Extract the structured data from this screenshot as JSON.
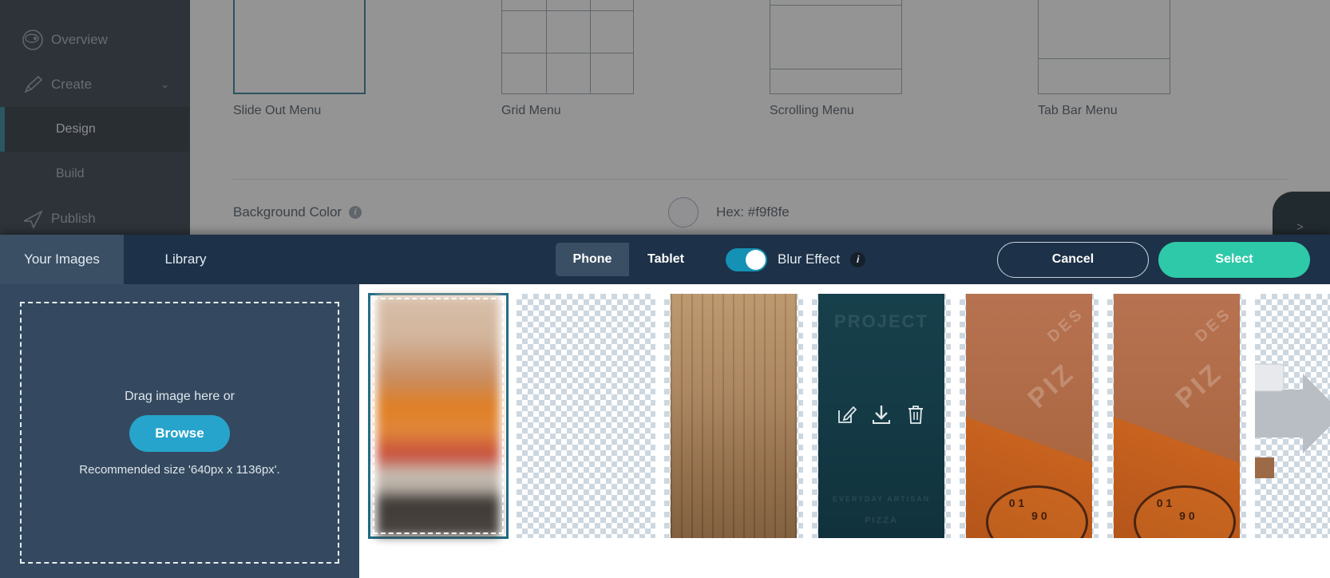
{
  "app": {
    "sidebar": {
      "items": [
        {
          "label": "Overview",
          "icon": "gauge-icon",
          "type": "top"
        },
        {
          "label": "Create",
          "icon": "pencil-icon",
          "type": "group",
          "chevron": "⌄"
        },
        {
          "label": "Design",
          "icon": "",
          "type": "sub",
          "active": true
        },
        {
          "label": "Build",
          "icon": "",
          "type": "sub",
          "active": false
        },
        {
          "label": "Publish",
          "icon": "send-icon",
          "type": "top"
        }
      ]
    },
    "templates": [
      {
        "caption": "Slide Out Menu",
        "kind": "slideout",
        "selected": true
      },
      {
        "caption": "Grid Menu",
        "kind": "grid",
        "selected": false
      },
      {
        "caption": "Scrolling Menu",
        "kind": "scrolling",
        "selected": false
      },
      {
        "caption": "Tab Bar Menu",
        "kind": "tabbar",
        "selected": false
      }
    ],
    "background_color": {
      "label": "Background Color",
      "info_icon": "info-icon",
      "hex_text": "Hex: #f9f8fe",
      "swatch_hex": "#f9f8fe"
    },
    "right_drawer_handle": ">"
  },
  "modal": {
    "tabs": [
      {
        "label": "Your Images",
        "active": true
      },
      {
        "label": "Library",
        "active": false
      }
    ],
    "device_segmented": [
      {
        "label": "Phone",
        "active": true
      },
      {
        "label": "Tablet",
        "active": false
      }
    ],
    "blur_effect": {
      "label": "Blur Effect",
      "enabled": true,
      "info_icon": "info-icon",
      "info_glyph": "i"
    },
    "buttons": {
      "cancel": "Cancel",
      "select": "Select"
    },
    "dropzone": {
      "drag_text": "Drag image here or",
      "browse_label": "Browse",
      "recommended": "Recommended size '640px x 1136px'."
    },
    "gallery": {
      "thumbnails": [
        {
          "id": 1,
          "kind": "blur-orange",
          "selected": true,
          "hover": false,
          "checker": false
        },
        {
          "id": 2,
          "kind": "empty-checker",
          "selected": false,
          "hover": false,
          "checker": true
        },
        {
          "id": 3,
          "kind": "wood",
          "selected": false,
          "hover": false,
          "checker": true
        },
        {
          "id": 4,
          "kind": "teal-poster",
          "selected": false,
          "hover": true,
          "checker": true
        },
        {
          "id": 5,
          "kind": "pizza",
          "selected": false,
          "hover": false,
          "checker": true
        },
        {
          "id": 6,
          "kind": "pizza",
          "selected": false,
          "hover": false,
          "checker": true
        },
        {
          "id": 7,
          "kind": "arrow-clip",
          "selected": false,
          "hover": false,
          "checker": true
        }
      ],
      "hover_actions": [
        {
          "name": "edit-icon",
          "glyph": "edit"
        },
        {
          "name": "download-icon",
          "glyph": "download"
        },
        {
          "name": "delete-icon",
          "glyph": "trash"
        }
      ],
      "poster_faint_lines": [
        "PROJECT",
        "EVERYDAY ARTISAN",
        "PIZZA"
      ]
    }
  },
  "colors": {
    "accent_teal": "#2ec9a8",
    "accent_blue": "#27a4cc",
    "toggle_on": "#1491b4",
    "modal_header": "#1d3148",
    "drop_panel": "#34495f",
    "sidebar": "#1b2937",
    "selected_border": "#1d6b85"
  }
}
